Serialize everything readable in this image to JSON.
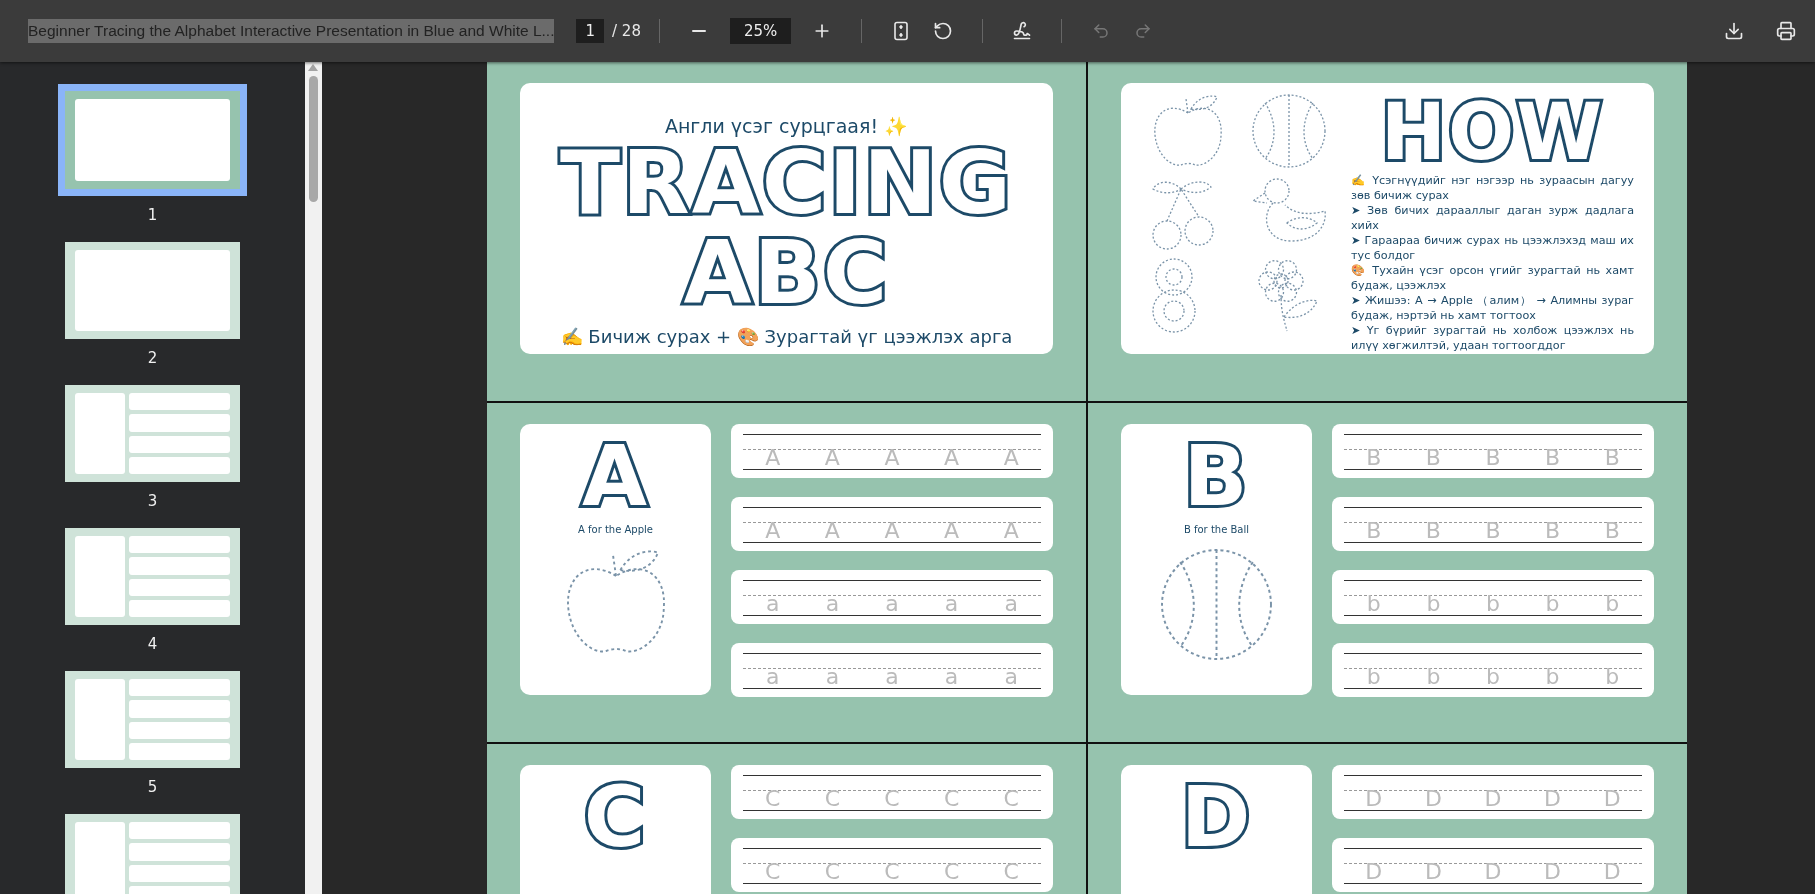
{
  "toolbar": {
    "title": "Beginner Tracing the Alphabet Interactive Presentation in Blue and White L...",
    "page": "1",
    "page_total": "/ 28",
    "zoom": "25%",
    "undo_disabled": true,
    "redo_disabled": true
  },
  "thumbnails": [
    {
      "label": "1",
      "selected": true,
      "kind": "title"
    },
    {
      "label": "2",
      "selected": false,
      "kind": "how"
    },
    {
      "label": "3",
      "selected": false,
      "kind": "letter"
    },
    {
      "label": "4",
      "selected": false,
      "kind": "letter"
    },
    {
      "label": "5",
      "selected": false,
      "kind": "letter"
    },
    {
      "selected": false,
      "kind": "letter"
    }
  ],
  "pages": [
    {
      "kind": "title",
      "subtitle": "Англи үсэг сурцгаая! ✨",
      "title_lines": [
        "TRACING",
        "ABC"
      ],
      "footer": "✍️ Бичиж сурах + 🎨 Зурагтай үг цээжлэх арга"
    },
    {
      "kind": "how",
      "heading": "HOW",
      "paragraphs": [
        "✍️ Үсэгнүүдийг нэг нэгээр нь зураасын дагуу зөв бичиж сурах",
        "➤ Зөв бичих дарааллыг даган зурж дадлага хийх",
        "➤ Гараараа бичиж сурах нь цээжлэхэд маш их тус болдог",
        "🎨 Тухайн үсэг орсон үгийг зурагтай нь хамт будаж, цээжлэх",
        "➤ Жишээ: A → Apple （алим） → Алимны зураг будаж, нэртэй нь хамт тогтоох",
        "➤ Үг бүрийг зурагтай нь холбож цээжлэх нь илүү хөгжилтэй, удаан тогтоогддог"
      ]
    },
    {
      "kind": "letter",
      "letter": "A",
      "caption": "A for the Apple",
      "rows": [
        [
          "A",
          "A",
          "A",
          "A",
          "A"
        ],
        [
          "A",
          "A",
          "A",
          "A",
          "A"
        ],
        [
          "a",
          "a",
          "a",
          "a",
          "a"
        ],
        [
          "a",
          "a",
          "a",
          "a",
          "a"
        ]
      ]
    },
    {
      "kind": "letter",
      "letter": "B",
      "caption": "B for the Ball",
      "rows": [
        [
          "B",
          "B",
          "B",
          "B",
          "B"
        ],
        [
          "B",
          "B",
          "B",
          "B",
          "B"
        ],
        [
          "b",
          "b",
          "b",
          "b",
          "b"
        ],
        [
          "b",
          "b",
          "b",
          "b",
          "b"
        ]
      ]
    },
    {
      "kind": "letter",
      "letter": "C",
      "rows": [
        [
          "C",
          "C",
          "C",
          "C",
          "C"
        ],
        [
          "C",
          "C",
          "C",
          "C",
          "C"
        ]
      ]
    },
    {
      "kind": "letter",
      "letter": "D",
      "rows": [
        [
          "D",
          "D",
          "D",
          "D",
          "D"
        ],
        [
          "D",
          "D",
          "D",
          "D",
          "D"
        ]
      ]
    }
  ]
}
